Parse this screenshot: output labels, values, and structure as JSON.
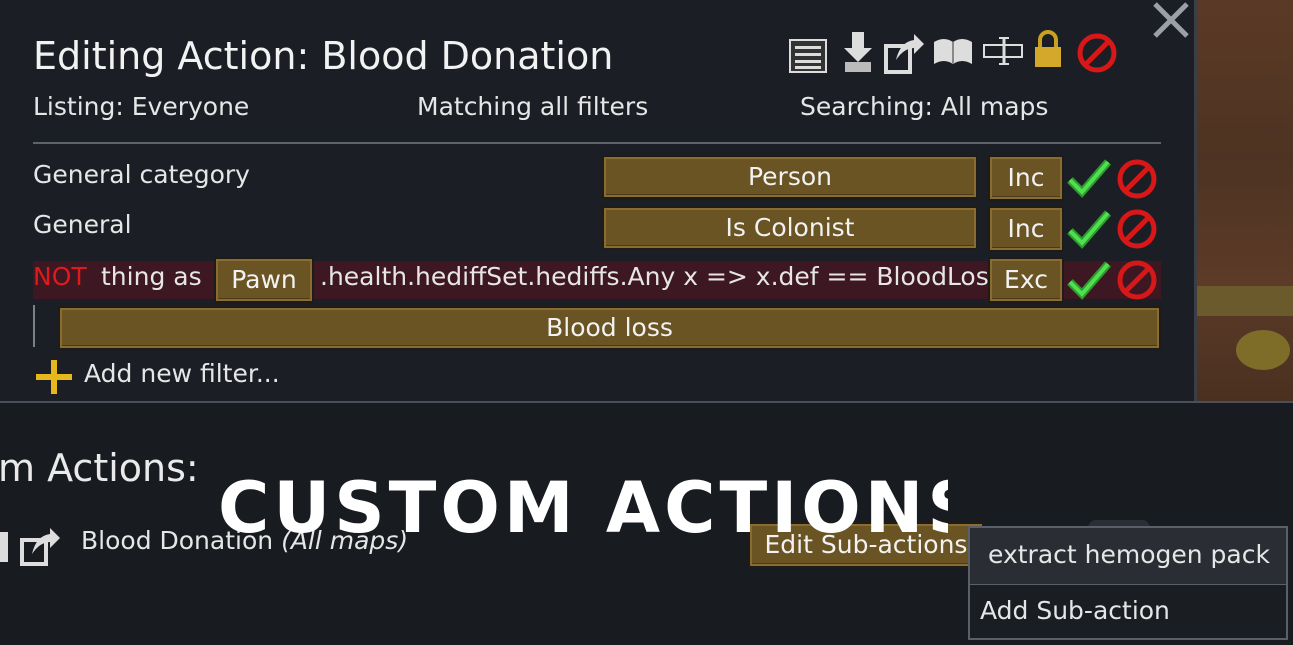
{
  "window": {
    "title": "Editing Action: Blood Donation",
    "listing": "Listing: Everyone",
    "matching": "Matching all filters",
    "searching": "Searching: All maps"
  },
  "toolbar_icons": [
    "list-icon",
    "download-icon",
    "export-icon",
    "book-icon",
    "text-cursor-icon",
    "lock-icon",
    "cancel-icon"
  ],
  "filters": [
    {
      "label": "General category",
      "value": "Person",
      "mode": "Inc"
    },
    {
      "label": "General",
      "value": "Is Colonist",
      "mode": "Inc"
    },
    {
      "not": "NOT",
      "label": "thing as",
      "type": "Pawn",
      "expr": ".health.hediffSet.hediffs.Any x => x.def == BloodLoss",
      "mode": "Exc",
      "sub_value": "Blood loss"
    }
  ],
  "add_filter": "Add new filter...",
  "actions_panel": {
    "heading": "m Actions:",
    "action_name": "Blood Donation",
    "action_scope": "(All maps)",
    "edit_sub_actions": "Edit Sub-actions"
  },
  "overlay_logo": "CUSTOM ACTIONS",
  "dropdown": {
    "items": [
      "extract hemogen pack",
      "Add Sub-action"
    ]
  },
  "colors": {
    "accent_red": "#e01a1a",
    "check_green": "#3ad13a",
    "button_brown": "#6a5424"
  }
}
